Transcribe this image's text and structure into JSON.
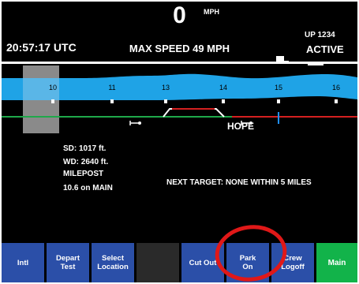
{
  "header": {
    "speed": "0",
    "speed_unit": "MPH",
    "clock": "20:57:17 UTC",
    "max_speed": "MAX SPEED 49 MPH",
    "train_id": "UP 1234",
    "status": "ACTIVE"
  },
  "track": {
    "mileposts": [
      "10",
      "11",
      "13",
      "14",
      "15",
      "16"
    ],
    "location_label": "HOPE",
    "colors": {
      "river": "#1fa3e6",
      "track_green": "#1fa84a",
      "track_red": "#d42020",
      "marker_blue": "#2090ff",
      "window_gray": "#8a8a8a"
    }
  },
  "info": {
    "sd": "SD:  1017 ft.",
    "wd": "WD:  2640 ft.",
    "milepost_label": "MILEPOST",
    "milepost_value": "10.6 on MAIN",
    "next_target": "NEXT TARGET: NONE WITHIN 5 MILES"
  },
  "softkeys": {
    "initl": "Intl",
    "depart_test": "Depart\nTest",
    "select_location": "Select\nLocation",
    "cut_out": "Cut Out",
    "park_on": "Park\nOn",
    "crew_logoff": "Crew\nLogoff",
    "main": "Main"
  },
  "colors": {
    "softkey_blue": "#2b4fa8",
    "main_green": "#12b34a",
    "annotation_red": "#e01818"
  }
}
